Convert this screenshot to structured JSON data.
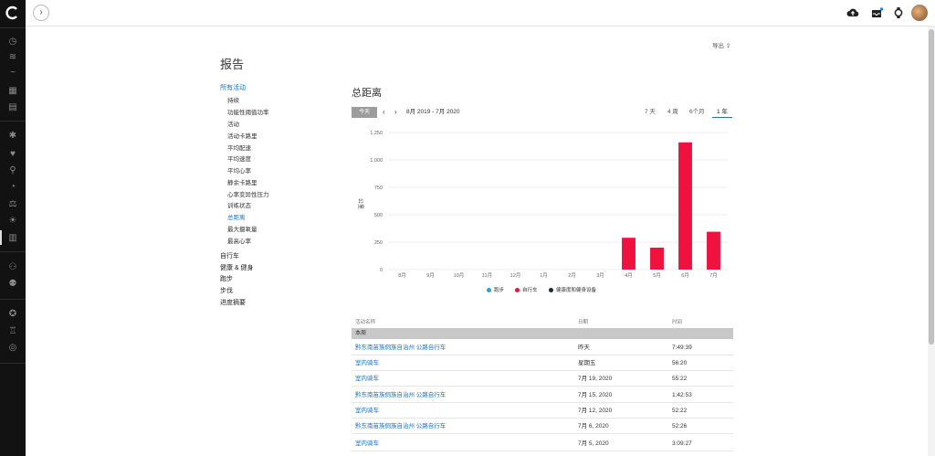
{
  "header": {
    "expand_glyph": "›"
  },
  "page": {
    "title": "报告",
    "export_label": "导出"
  },
  "sidebar_nav": {
    "groups": [
      {
        "label": "所有活动",
        "active": true
      },
      {
        "label": "自行车"
      },
      {
        "label": "健康 & 健身"
      },
      {
        "label": "跑步"
      },
      {
        "label": "步伐"
      },
      {
        "label": "进度摘要"
      }
    ],
    "sub_items": [
      "持续",
      "功能性阈值功率",
      "活动",
      "活动卡路里",
      "平均配速",
      "平均速度",
      "平均心率",
      "静余卡路里",
      "心率变异性压力",
      "训练状态",
      "总距离",
      "最大摄氧量",
      "最高心率"
    ],
    "active_sub_index": 10
  },
  "section": {
    "title": "总距离",
    "today_label": "今天",
    "prev_glyph": "‹",
    "next_glyph": "›",
    "date_range": "8月 2019 - 7月 2020",
    "range_tabs": [
      "7 天",
      "4 周",
      "6个月",
      "1 年"
    ],
    "active_range": "1 年"
  },
  "chart_data": {
    "type": "bar",
    "ylabel": "公里",
    "ylim": [
      0,
      1250
    ],
    "yticks": [
      "0",
      "250",
      "500",
      "750",
      "1,000",
      "1,250"
    ],
    "categories": [
      "8月",
      "9月",
      "10月",
      "11月",
      "12月",
      "1月",
      "2月",
      "3月",
      "4月",
      "5月",
      "6月",
      "7月"
    ],
    "series": [
      {
        "name": "跑步",
        "color": "#19a8e0",
        "values": [
          0,
          0,
          0,
          0,
          0,
          0,
          0,
          0,
          0,
          0,
          0,
          0
        ]
      },
      {
        "name": "自行车",
        "color": "#f0113f",
        "values": [
          0,
          0,
          0,
          0,
          0,
          0,
          0,
          0,
          290,
          200,
          1160,
          345
        ]
      },
      {
        "name": "健康度和健身设备",
        "color": "#1b2b3c",
        "values": [
          0,
          0,
          0,
          0,
          0,
          0,
          0,
          0,
          0,
          0,
          0,
          0
        ]
      }
    ],
    "grid": true,
    "legend": "bottom"
  },
  "table": {
    "columns": [
      "活动名称",
      "日期",
      "时间"
    ],
    "group_label": "本周",
    "rows": [
      {
        "name": "黔东南苗族侗族自治州 公路自行车",
        "date": "昨天",
        "time": "7:49:39"
      },
      {
        "name": "室内骑车",
        "date": "星期五",
        "time": "56:20"
      },
      {
        "name": "室内骑车",
        "date": "7月 19, 2020",
        "time": "55:22"
      },
      {
        "name": "黔东南苗族侗族自治州 公路自行车",
        "date": "7月 15, 2020",
        "time": "1:42:53"
      },
      {
        "name": "室内骑车",
        "date": "7月 12, 2020",
        "time": "52:22"
      },
      {
        "name": "黔东南苗族侗族自治州 公路自行车",
        "date": "7月 6, 2020",
        "time": "52:26"
      },
      {
        "name": "室内骑车",
        "date": "7月 5, 2020",
        "time": "3:09:27"
      }
    ]
  }
}
